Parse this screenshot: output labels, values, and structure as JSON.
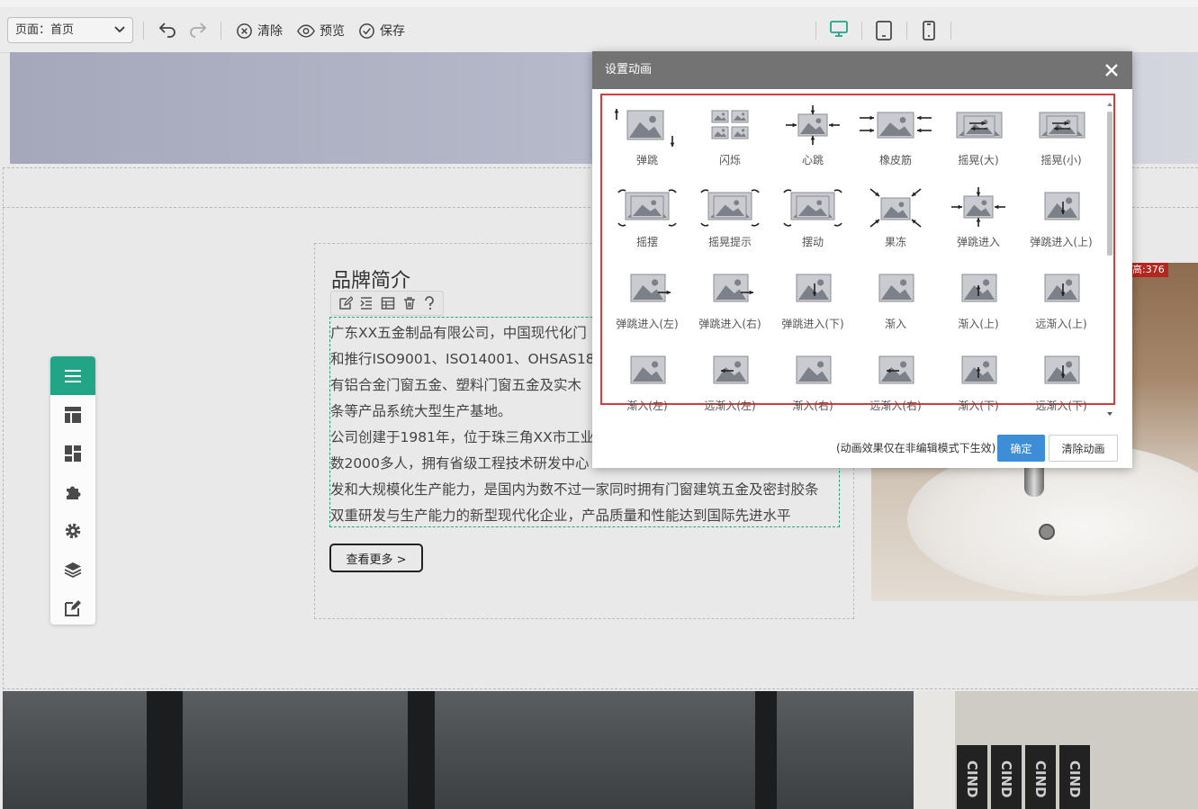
{
  "toolbar": {
    "page_select_value": "页面：首页",
    "clear_label": "清除",
    "preview_label": "预览",
    "save_label": "保存"
  },
  "brand": {
    "title": "品牌简介",
    "lines": [
      "广东XX五金制品有限公司，中国现代化门",
      "和推行ISO9001、ISO14001、OHSAS18",
      "有铝合金门窗五金、塑料门窗五金及实木",
      "条等产品系统大型生产基地。",
      "公司创建于1981年，位于珠三角XX市工业",
      "数2000多人，拥有省级工程技术研发中心",
      "发和大规模化生产能力，是国内为数不过一家同时拥有门窗建筑五金及密封胶条",
      "双重研发与生产能力的新型现代化企业，产品质量和性能达到国际先进水平"
    ],
    "more_button": "查看更多 >"
  },
  "image_tag": "高:376",
  "bottom_books": [
    "CIND",
    "CIND",
    "CIND",
    "CIND"
  ],
  "modal": {
    "title": "设置动画",
    "animations": [
      "弹跳",
      "闪烁",
      "心跳",
      "橡皮筋",
      "摇晃(大)",
      "摇晃(小)",
      "摇摆",
      "摇晃提示",
      "摆动",
      "果冻",
      "弹跳进入",
      "弹跳进入(上)",
      "弹跳进入(左)",
      "弹跳进入(右)",
      "弹跳进入(下)",
      "渐入",
      "渐入(上)",
      "远渐入(上)",
      "渐入(左)",
      "远渐入(左)",
      "渐入(右)",
      "远渐入(右)",
      "渐入(下)",
      "远渐入(下)"
    ],
    "note": "(动画效果仅在非编辑模式下生效)",
    "ok_label": "确定",
    "clear_label": "清除动画"
  },
  "colors": {
    "accent": "#21a586",
    "modal_header": "#737373",
    "highlight_border": "#d8393a",
    "ok_button": "#3d8ed6"
  }
}
